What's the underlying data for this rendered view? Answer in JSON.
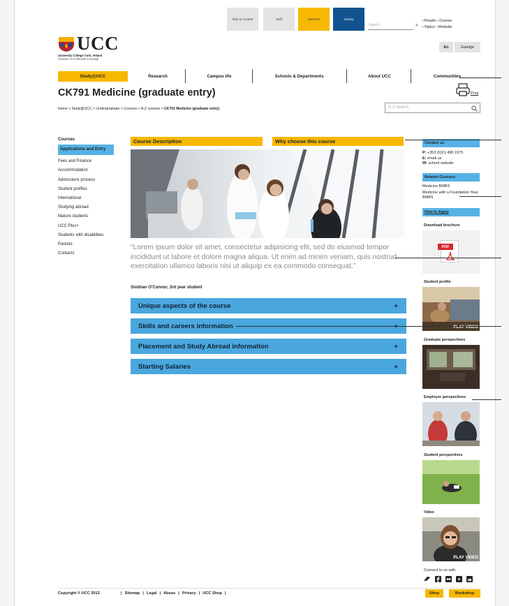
{
  "topbar": {
    "skip": "Skip to content",
    "staff": "Staff",
    "students": "Students",
    "library": "Library",
    "search_placeholder": "Search",
    "search_go": ">",
    "radios": [
      "People",
      "Course",
      "Topics",
      "Website"
    ]
  },
  "logo": {
    "name": "UCC",
    "line1": "University College Cork, Ireland",
    "line2": "Coláiste na hOllscoile Corcaigh"
  },
  "lang": {
    "en": "En",
    "ga": "Gaeilge"
  },
  "nav": [
    "Study@UCC",
    "Research",
    "Campus life",
    "Schools & Departments",
    "About UCC",
    "Communities"
  ],
  "page_title": "CK791 Medicine (graduate entry)",
  "print": "Print",
  "breadcrumb": {
    "path": "Home > Study@UCC > Undergraduate > Courses > A-Z courses > ",
    "current": "CK791 Medicine (graduate entry)"
  },
  "az_search_placeholder": "A-Z search",
  "left_nav": {
    "heading": "Courses",
    "active": "Applications and Entry",
    "items": [
      "Fees and Finance",
      "Accommodation",
      "Admissions process",
      "Student profiles",
      "International",
      "Studying abroad",
      "Mature students",
      "UCC Plus+",
      "Students with disabilities",
      "Parents",
      "Contacts"
    ]
  },
  "tabs": {
    "course_description": "Course Description",
    "why_choose": "Why choose this course"
  },
  "quote": {
    "text": "“Lorem ipsum dolor sit amet, consectetur adipisicing elit, sed do eiusmod tempor incididunt ut labore et dolore magna aliqua. Ut enim ad minim veniam, quis nostrud exercitation ullamco laboris nisi ut aliquip ex ea commodo consequat.”",
    "author": "Siobhan O'Connor, 3rd year student"
  },
  "accordions": [
    {
      "label": "Unique aspects of the course",
      "icon": "+"
    },
    {
      "label": "Skills and careers information",
      "icon": "+"
    },
    {
      "label": "Placement and Study Abroad information",
      "icon": "+"
    },
    {
      "label": "Starting Salaries",
      "icon": "+"
    }
  ],
  "sidebar": {
    "contact_title": "Contact us",
    "phone_label": "P:",
    "phone": "+353 (0)21 490 1575",
    "email_label": "E:",
    "email": "email us",
    "web_label": "W:",
    "web": "school website",
    "related_title": "Related Courses:",
    "related": [
      "Medicine BMBS",
      "Medicine with a Foundation Year BMBS"
    ],
    "how_to_apply": "How to Apply",
    "download_brochure": "Download brochure",
    "pdf_label": "PDF",
    "student_profile": "Student profile",
    "play_video": "PLAY VIDEO",
    "graduate_perspectives": "Graduate perspectives",
    "employer_perspectives": "Employer perspectives",
    "student_perspectives": "Student perspectives",
    "video": "Video",
    "connect": "Connect to us with:"
  },
  "footer": {
    "copyright": "Copyright © UCC 2012",
    "links": [
      "Sitemap",
      "Legal",
      "Abuse",
      "Privacy",
      "UCC Shop"
    ],
    "shop": "Shop",
    "bookshop": "Bookshop"
  },
  "colors": {
    "orange": "#f7b800",
    "blue": "#56b2e5",
    "navy": "#11538f"
  }
}
